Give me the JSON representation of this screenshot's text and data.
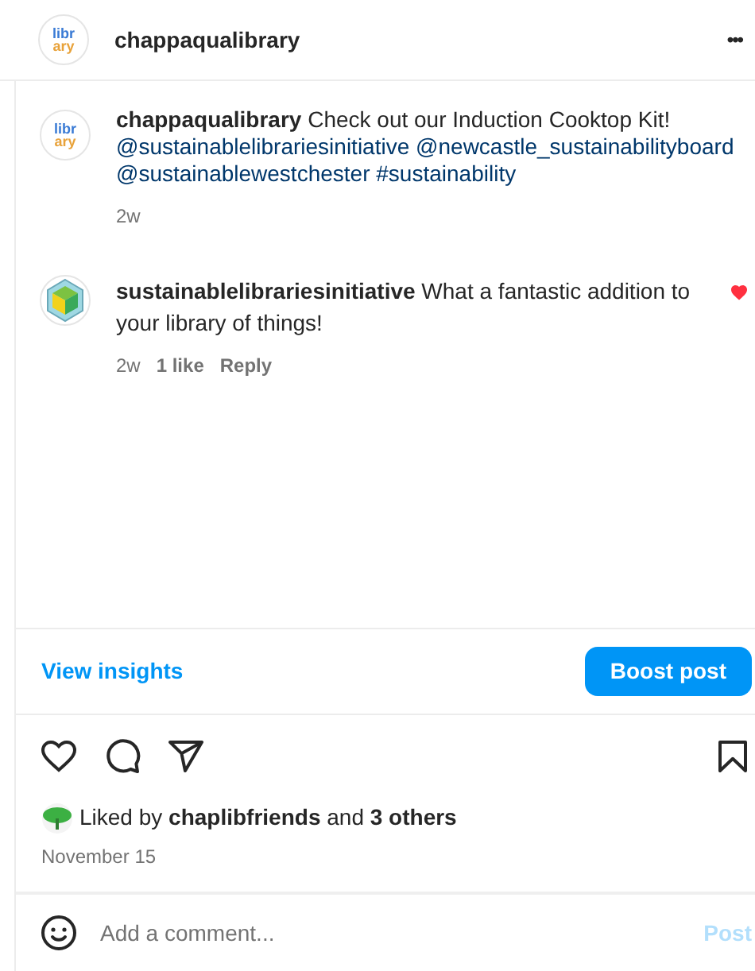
{
  "header": {
    "avatar_text": [
      "libr",
      "ary"
    ],
    "username": "chappaqualibrary",
    "menu": "•••"
  },
  "caption": {
    "avatar_text": [
      "libr",
      "ary"
    ],
    "username": "chappaqualibrary",
    "text": "Check out our Induction Cooktop Kit!",
    "tags": [
      "@sustainablelibrariesinitiative",
      "@newcastle_sustainabilityboard",
      "@sustainablewestchester",
      "#sustainability"
    ],
    "time": "2w"
  },
  "comments": [
    {
      "username": "sustainablelibrariesinitiative",
      "text": "What a fantastic addition to your library of things!",
      "time": "2w",
      "likes": "1 like",
      "reply": "Reply",
      "liked": true
    }
  ],
  "insights": {
    "link": "View insights",
    "button": "Boost post"
  },
  "actions": {
    "liked": false,
    "saved": false
  },
  "likes": "Liked by **chaplibfriends** and **3 others**",
  "date": "November 15",
  "add_comment": {
    "placeholder": "Add a comment...",
    "button": "Post"
  }
}
